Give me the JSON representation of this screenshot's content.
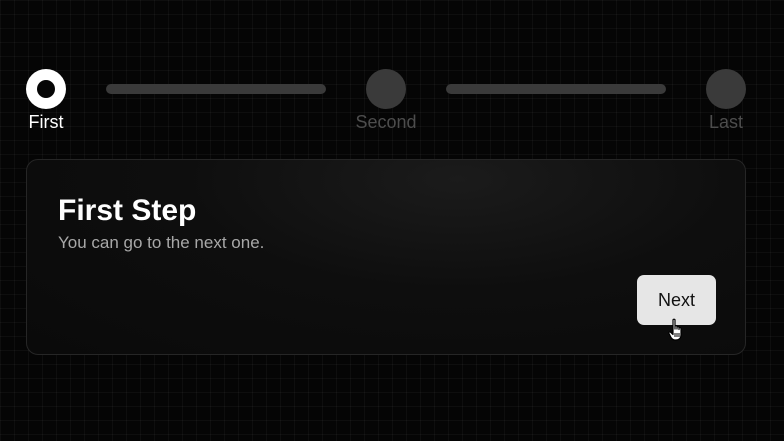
{
  "stepper": {
    "steps": [
      {
        "label": "First",
        "state": "active"
      },
      {
        "label": "Second",
        "state": "inactive"
      },
      {
        "label": "Last",
        "state": "inactive"
      }
    ]
  },
  "card": {
    "title": "First Step",
    "subtitle": "You can go to the next one.",
    "next_label": "Next"
  },
  "cursor": {
    "icon": "hand-pointer-icon"
  },
  "colors": {
    "background": "#050505",
    "active_step": "#ffffff",
    "inactive_step": "#3a3a3a",
    "button_bg": "#e6e6e6"
  }
}
